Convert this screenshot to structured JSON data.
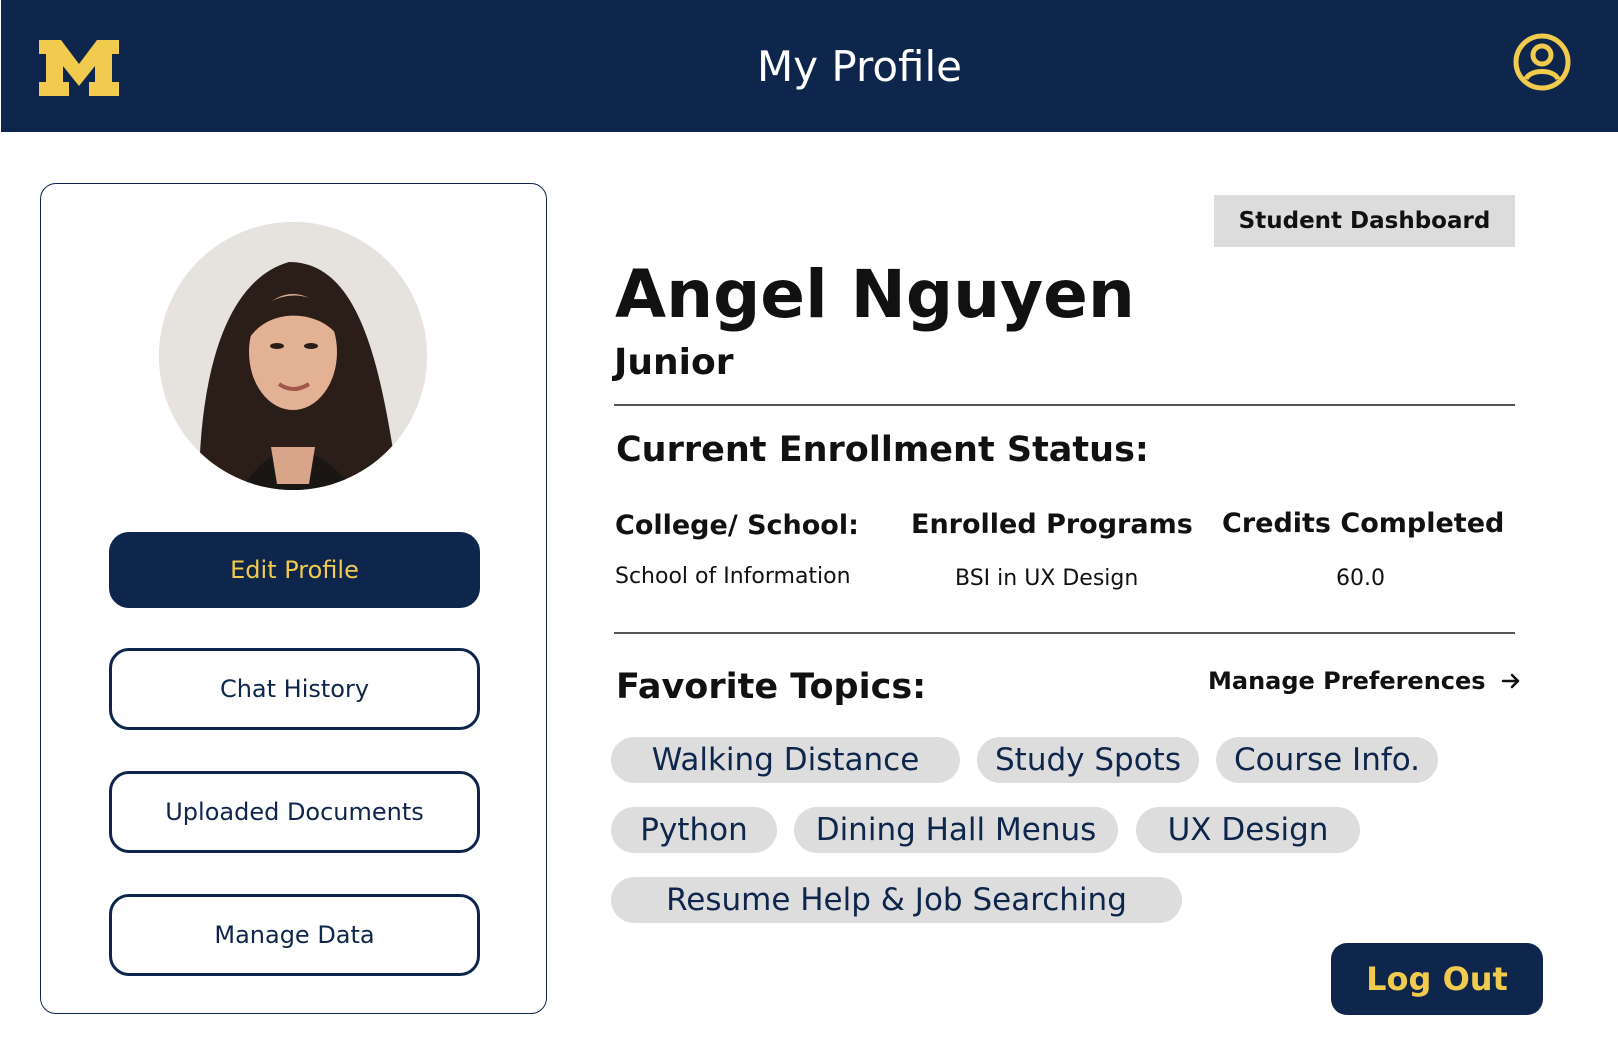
{
  "header": {
    "title": "My Profile",
    "logo_letter": "M",
    "brand_color": "#0e264b",
    "accent_color": "#f1cb4e",
    "account_icon": "account-circle-icon"
  },
  "sidebar": {
    "avatar": "profile-photo",
    "buttons": [
      {
        "label": "Edit Profile"
      },
      {
        "label": "Chat History"
      },
      {
        "label": "Uploaded Documents"
      },
      {
        "label": "Manage Data"
      }
    ]
  },
  "profile": {
    "dashboard_button": "Student Dashboard",
    "name": "Angel Nguyen",
    "year": "Junior"
  },
  "enrollment": {
    "title": "Current Enrollment Status:",
    "columns": [
      {
        "header": "College/ School:",
        "value": "School of Information"
      },
      {
        "header": "Enrolled Programs",
        "value": "BSI in UX Design"
      },
      {
        "header": "Credits Completed",
        "value": "60.0"
      }
    ]
  },
  "topics": {
    "title": "Favorite Topics:",
    "manage_label": "Manage Preferences",
    "manage_icon": "arrow-right-icon",
    "chips": [
      "Walking Distance",
      "Study Spots",
      "Course Info.",
      "Python",
      "Dining Hall Menus",
      "UX Design",
      "Resume Help & Job Searching"
    ]
  },
  "footer": {
    "logout_label": "Log Out"
  }
}
